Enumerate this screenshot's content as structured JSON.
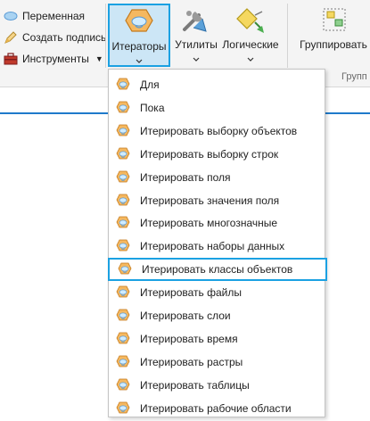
{
  "ribbon": {
    "small_commands": [
      {
        "label": "Переменная",
        "icon": "variable-ellipse-icon"
      },
      {
        "label": "Создать подпись",
        "icon": "label-pencil-icon"
      },
      {
        "label": "Инструменты",
        "icon": "toolbox-icon"
      }
    ],
    "big_buttons": [
      {
        "label": "Итераторы",
        "icon": "iterator-icon",
        "active": true
      },
      {
        "label": "Утилиты",
        "icon": "utilities-tools-icon"
      },
      {
        "label": "Логические",
        "icon": "logical-diamond-icon"
      },
      {
        "label": "Группировать",
        "icon": "group-icon"
      }
    ],
    "group_label_partial": "Групп"
  },
  "menu": {
    "items": [
      {
        "label": "Для",
        "mnemonic": "Д"
      },
      {
        "label": "Пока",
        "mnemonic": "П"
      },
      {
        "label": "Итерировать выборку объектов",
        "mnemonic": "в"
      },
      {
        "label": "Итерировать выборку строк",
        "mnemonic": "б"
      },
      {
        "label": "Итерировать поля",
        "mnemonic": "т"
      },
      {
        "label": "Итерировать значения поля",
        "mnemonic": "з"
      },
      {
        "label": "Итерировать многозначные",
        "mnemonic": "м"
      },
      {
        "label": "Итерировать наборы данных",
        "mnemonic": "н"
      },
      {
        "label": "Итерировать классы объектов",
        "mnemonic": "к",
        "selected": true
      },
      {
        "label": "Итерировать файлы",
        "mnemonic": "ф"
      },
      {
        "label": "Итерировать слои",
        "mnemonic": "с"
      },
      {
        "label": "Итерировать время",
        "mnemonic": "е"
      },
      {
        "label": "Итерировать растры",
        "mnemonic": "р"
      },
      {
        "label": "Итерировать таблицы",
        "mnemonic": "т"
      },
      {
        "label": "Итерировать рабочие области",
        "mnemonic": "р"
      }
    ]
  },
  "colors": {
    "accent": "#1ba1e2",
    "active_fill": "#cce6f6",
    "iterator_orange": "#f2a541"
  }
}
